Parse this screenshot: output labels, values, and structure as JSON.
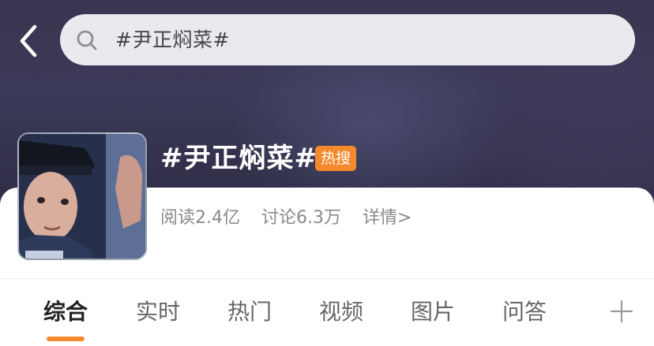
{
  "header": {
    "back_icon": "chevron-left-icon",
    "search": {
      "icon": "search-icon",
      "value": "#尹正焖菜#"
    }
  },
  "topic": {
    "title": "#尹正焖菜#",
    "badge": "热搜",
    "badge_color": "#f58a2c",
    "thumbnail": "topic-thumbnail-image",
    "stats": {
      "reads": "阅读2.4亿",
      "discussions": "讨论6.3万",
      "detail": "详情>"
    }
  },
  "tabs": {
    "items": [
      "综合",
      "实时",
      "热门",
      "视频",
      "图片",
      "问答"
    ],
    "active_index": 0,
    "accent_color": "#f58a2c",
    "add_icon": "plus-icon"
  }
}
